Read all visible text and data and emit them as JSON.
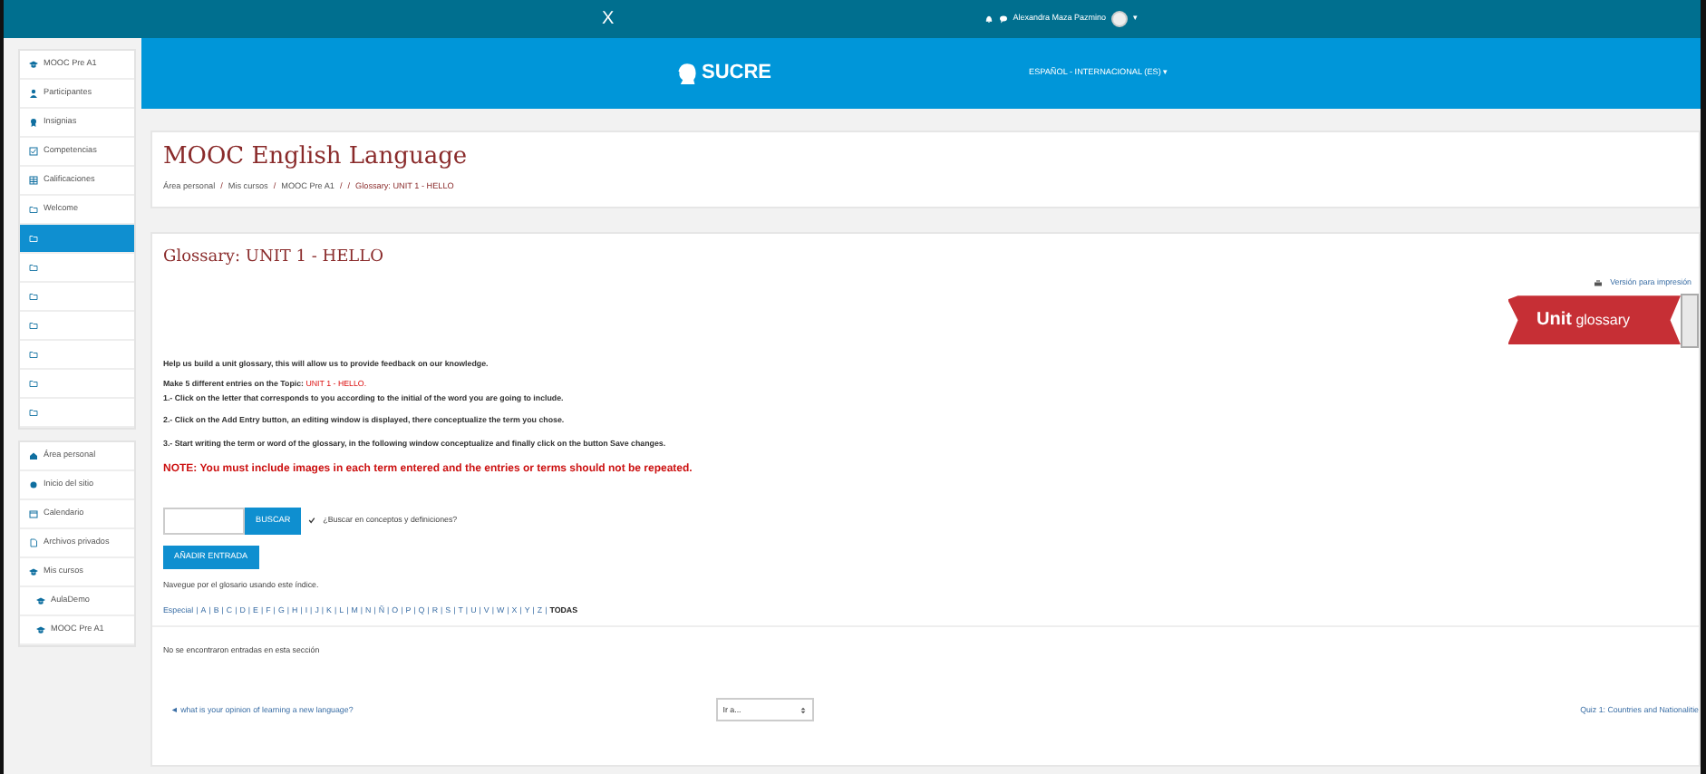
{
  "top_bar": {
    "close": "X",
    "user_name": "Alexandra Maza Pazmino",
    "caret": "▾"
  },
  "header": {
    "logo_text": "SUCRE",
    "language": "ESPAÑOL - INTERNACIONAL (ES)",
    "language_caret": "▾"
  },
  "sidebar": {
    "course_items": [
      {
        "label": "MOOC Pre A1",
        "selected": false
      },
      {
        "label": "Participantes",
        "selected": false
      },
      {
        "label": "Insignias",
        "selected": false
      },
      {
        "label": "Competencias",
        "selected": false
      },
      {
        "label": "Calificaciones",
        "selected": false
      },
      {
        "label": "Welcome",
        "selected": false
      },
      {
        "selected": true
      },
      {
        "selected": false
      },
      {
        "selected": false
      },
      {
        "selected": false
      },
      {
        "selected": false
      },
      {
        "selected": false
      },
      {
        "selected": false
      }
    ],
    "site_items": [
      {
        "label": "Área personal"
      },
      {
        "label": "Inicio del sitio"
      },
      {
        "label": "Calendario"
      },
      {
        "label": "Archivos privados"
      },
      {
        "label": "Mis cursos",
        "children": [
          {
            "label": "AulaDemo"
          },
          {
            "label": "MOOC Pre A1"
          }
        ]
      }
    ]
  },
  "page_header": {
    "title": "MOOC English Language",
    "breadcrumb": [
      {
        "kind": "link",
        "text": "Área personal"
      },
      {
        "kind": "separator",
        "text": "/"
      },
      {
        "kind": "link",
        "text": "Mis cursos"
      },
      {
        "kind": "separator",
        "text": "/"
      },
      {
        "kind": "link",
        "text": "MOOC Pre A1"
      },
      {
        "kind": "separator",
        "text": "/"
      },
      {
        "kind": "separator",
        "text": "/"
      },
      {
        "kind": "current",
        "text": "Glossary: UNIT 1 - HELLO"
      }
    ]
  },
  "glossary": {
    "title": "Glossary: UNIT 1 - HELLO",
    "print_link": "Versión para impresión",
    "banner": "**Unit** glossary",
    "intro": "Help us build a unit glossary, this will allow us to provide feedback on our knowledge.",
    "topic_prefix": "Make 5 different entries on the Topic:",
    "topic": "UNIT 1 - HELLO.",
    "steps": [
      "1.- Click on the letter that corresponds to you according to the initial of the word you are going to include.",
      "2.- Click on the Add Entry button, an editing window is displayed, there conceptualize the term you chose.",
      "3.- Start writing the term or word of the glossary, in the following window conceptualize and finally click on the button Save changes."
    ],
    "note": "NOTE: You must include images in each term entered and the entries or terms should not be repeated.",
    "search_button": "BUSCAR",
    "search_full": {
      "label": "¿Buscar en conceptos y definiciones?",
      "checked": true
    },
    "add_button": "AÑADIR ENTRADA",
    "browse_text": "Navegue por el glosario usando este índice.",
    "letters": [
      {
        "text": "Especial",
        "selected": false
      },
      {
        "text": "A",
        "selected": false
      },
      {
        "text": "B",
        "selected": false
      },
      {
        "text": "C",
        "selected": false
      },
      {
        "text": "D",
        "selected": false
      },
      {
        "text": "E",
        "selected": false
      },
      {
        "text": "F",
        "selected": false
      },
      {
        "text": "G",
        "selected": false
      },
      {
        "text": "H",
        "selected": false
      },
      {
        "text": "I",
        "selected": false
      },
      {
        "text": "J",
        "selected": false
      },
      {
        "text": "K",
        "selected": false
      },
      {
        "text": "L",
        "selected": false
      },
      {
        "text": "M",
        "selected": false
      },
      {
        "text": "N",
        "selected": false
      },
      {
        "text": "Ñ",
        "selected": false
      },
      {
        "text": "O",
        "selected": false
      },
      {
        "text": "P",
        "selected": false
      },
      {
        "text": "Q",
        "selected": false
      },
      {
        "text": "R",
        "selected": false
      },
      {
        "text": "S",
        "selected": false
      },
      {
        "text": "T",
        "selected": false
      },
      {
        "text": "U",
        "selected": false
      },
      {
        "text": "V",
        "selected": false
      },
      {
        "text": "W",
        "selected": false
      },
      {
        "text": "X",
        "selected": false
      },
      {
        "text": "Y",
        "selected": false
      },
      {
        "text": "Z",
        "selected": false
      },
      {
        "text": "TODAS",
        "selected": true
      }
    ],
    "letter_separator": "|",
    "empty_text": "No se encontraron entradas en esta sección",
    "prev_link": "◄ what is your opinion of learning a new language?",
    "jump_select": "Ir a...",
    "next_link": "Quiz 1: Countries and Nationalitie"
  }
}
